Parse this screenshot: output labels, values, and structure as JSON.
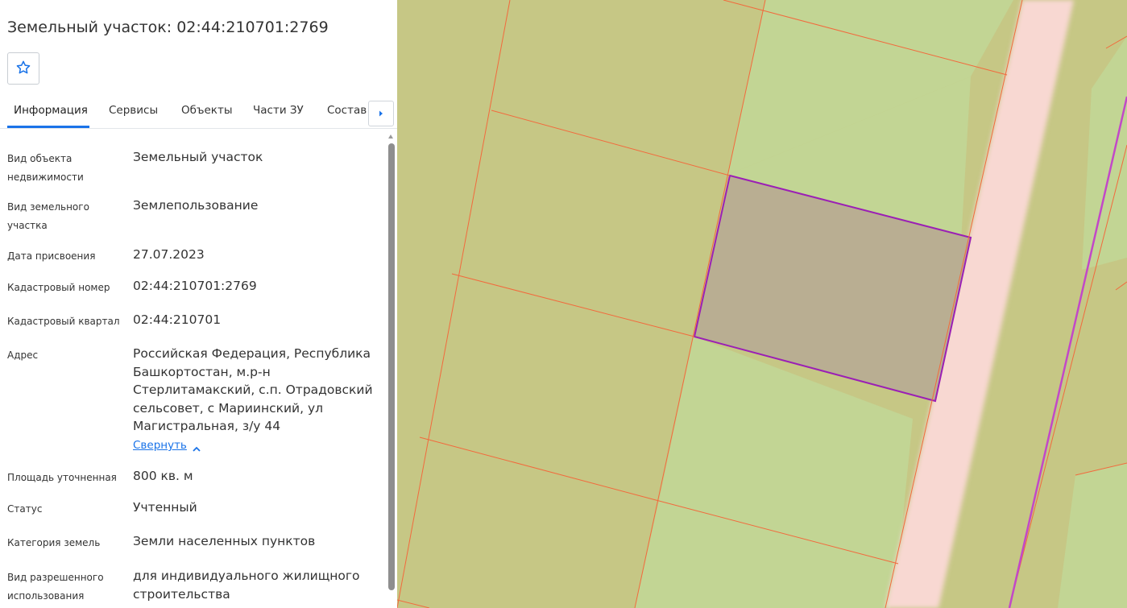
{
  "header": {
    "title": "Земельный участок: 02:44:210701:2769"
  },
  "tabs": [
    {
      "label": "Информация",
      "active": true
    },
    {
      "label": "Сервисы"
    },
    {
      "label": "Объекты"
    },
    {
      "label": "Части ЗУ"
    },
    {
      "label": "Состав"
    }
  ],
  "info": [
    {
      "label": "Вид объекта недвижимости",
      "value": "Земельный участок"
    },
    {
      "label": "Вид земельного участка",
      "value": "Землепользование"
    },
    {
      "label": "Дата присвоения",
      "value": "27.07.2023"
    },
    {
      "label": "Кадастровый номер",
      "value": "02:44:210701:2769"
    },
    {
      "label": "Кадастровый квартал",
      "value": "02:44:210701"
    },
    {
      "label": "Адрес",
      "value": "Российская Федерация, Республика Башкортостан, м.р-н Стерлитамакский, с.п. Отрадовский сельсовет, с Мариинский, ул Магистральная, з/у 44"
    },
    {
      "label": "Площадь уточненная",
      "value": "800 кв. м"
    },
    {
      "label": "Статус",
      "value": "Учтенный"
    },
    {
      "label": "Категория земель",
      "value": "Земли населенных пунктов"
    },
    {
      "label": "Вид разрешенного использования",
      "value": "для индивидуального жилищного строительства"
    }
  ],
  "address_toggle": "Свернуть",
  "icons": {
    "favorite": "star-outline-icon",
    "tabs_scroll": "caret-right-icon",
    "collapse": "chevron-up-icon"
  },
  "colors": {
    "accent": "#1a73e8",
    "map_plot_olive": "#c6c785",
    "map_plot_green": "#c2d594",
    "map_road": "#f8d8d2",
    "map_boundary": "#f26a3d",
    "selected_outline": "#9b1fb5",
    "selected_fill": "#b9ae92"
  }
}
